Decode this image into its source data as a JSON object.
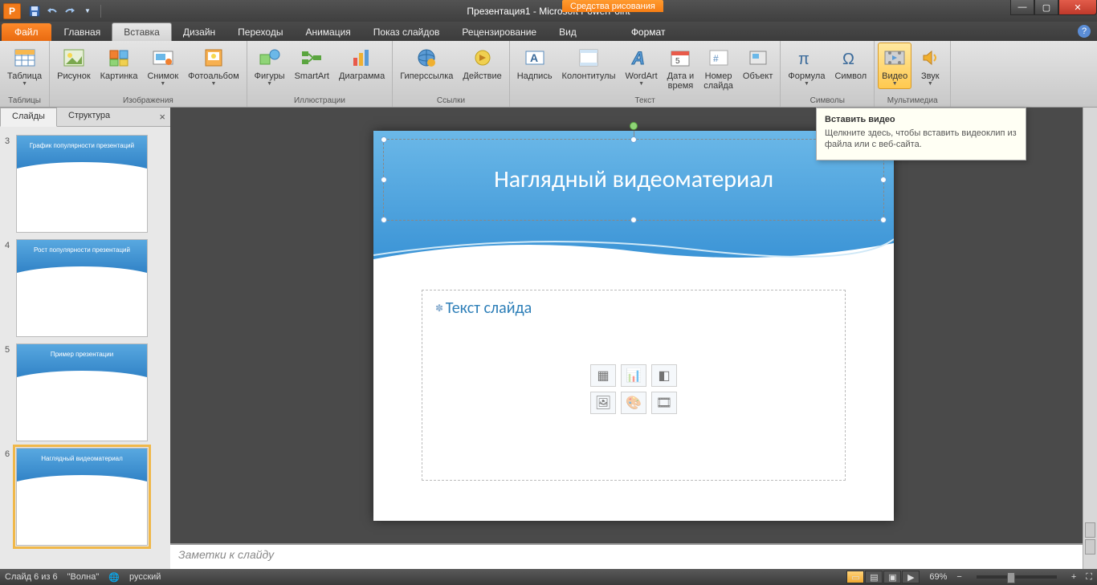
{
  "titlebar": {
    "doc_title": "Презентация1 - Microsoft PowerPoint",
    "context_label": "Средства рисования"
  },
  "tabs": {
    "file": "Файл",
    "items": [
      "Главная",
      "Вставка",
      "Дизайн",
      "Переходы",
      "Анимация",
      "Показ слайдов",
      "Рецензирование",
      "Вид"
    ],
    "active_index": 1,
    "context_tab": "Формат"
  },
  "ribbon": {
    "groups": [
      {
        "label": "Таблицы",
        "buttons": [
          {
            "key": "table",
            "label": "Таблица",
            "drop": true
          }
        ]
      },
      {
        "label": "Изображения",
        "buttons": [
          {
            "key": "picture",
            "label": "Рисунок"
          },
          {
            "key": "clipart",
            "label": "Картинка"
          },
          {
            "key": "screenshot",
            "label": "Снимок",
            "drop": true
          },
          {
            "key": "photoalbum",
            "label": "Фотоальбом",
            "drop": true
          }
        ]
      },
      {
        "label": "Иллюстрации",
        "buttons": [
          {
            "key": "shapes",
            "label": "Фигуры",
            "drop": true
          },
          {
            "key": "smartart",
            "label": "SmartArt"
          },
          {
            "key": "chart",
            "label": "Диаграмма"
          }
        ]
      },
      {
        "label": "Ссылки",
        "buttons": [
          {
            "key": "hyperlink",
            "label": "Гиперссылка"
          },
          {
            "key": "action",
            "label": "Действие"
          }
        ]
      },
      {
        "label": "Текст",
        "buttons": [
          {
            "key": "textbox",
            "label": "Надпись"
          },
          {
            "key": "headerfooter",
            "label": "Колонтитулы"
          },
          {
            "key": "wordart",
            "label": "WordArt",
            "drop": true
          },
          {
            "key": "datetime",
            "label": "Дата и\nвремя"
          },
          {
            "key": "slidenumber",
            "label": "Номер\nслайда"
          },
          {
            "key": "object",
            "label": "Объект"
          }
        ]
      },
      {
        "label": "Символы",
        "buttons": [
          {
            "key": "equation",
            "label": "Формула",
            "drop": true
          },
          {
            "key": "symbol",
            "label": "Символ"
          }
        ]
      },
      {
        "label": "Мультимедиа",
        "buttons": [
          {
            "key": "video",
            "label": "Видео",
            "drop": true,
            "highlight": true
          },
          {
            "key": "audio",
            "label": "Звук",
            "drop": true
          }
        ]
      }
    ]
  },
  "thumb_panel": {
    "tab_slides": "Слайды",
    "tab_outline": "Структура",
    "slides": [
      {
        "num": "3",
        "title": "График популярности презентаций"
      },
      {
        "num": "4",
        "title": "Рост популярности презентаций"
      },
      {
        "num": "5",
        "title": "Пример презентации"
      },
      {
        "num": "6",
        "title": "Наглядный видеоматериал",
        "selected": true
      }
    ]
  },
  "slide": {
    "title": "Наглядный видеоматериал",
    "content_placeholder": "Текст слайда"
  },
  "tooltip": {
    "title": "Вставить видео",
    "body": "Щелкните здесь, чтобы вставить видеоклип из файла или с веб-сайта."
  },
  "notes": {
    "placeholder": "Заметки к слайду"
  },
  "statusbar": {
    "slide_of": "Слайд 6 из 6",
    "theme": "\"Волна\"",
    "language": "русский",
    "zoom": "69%"
  }
}
